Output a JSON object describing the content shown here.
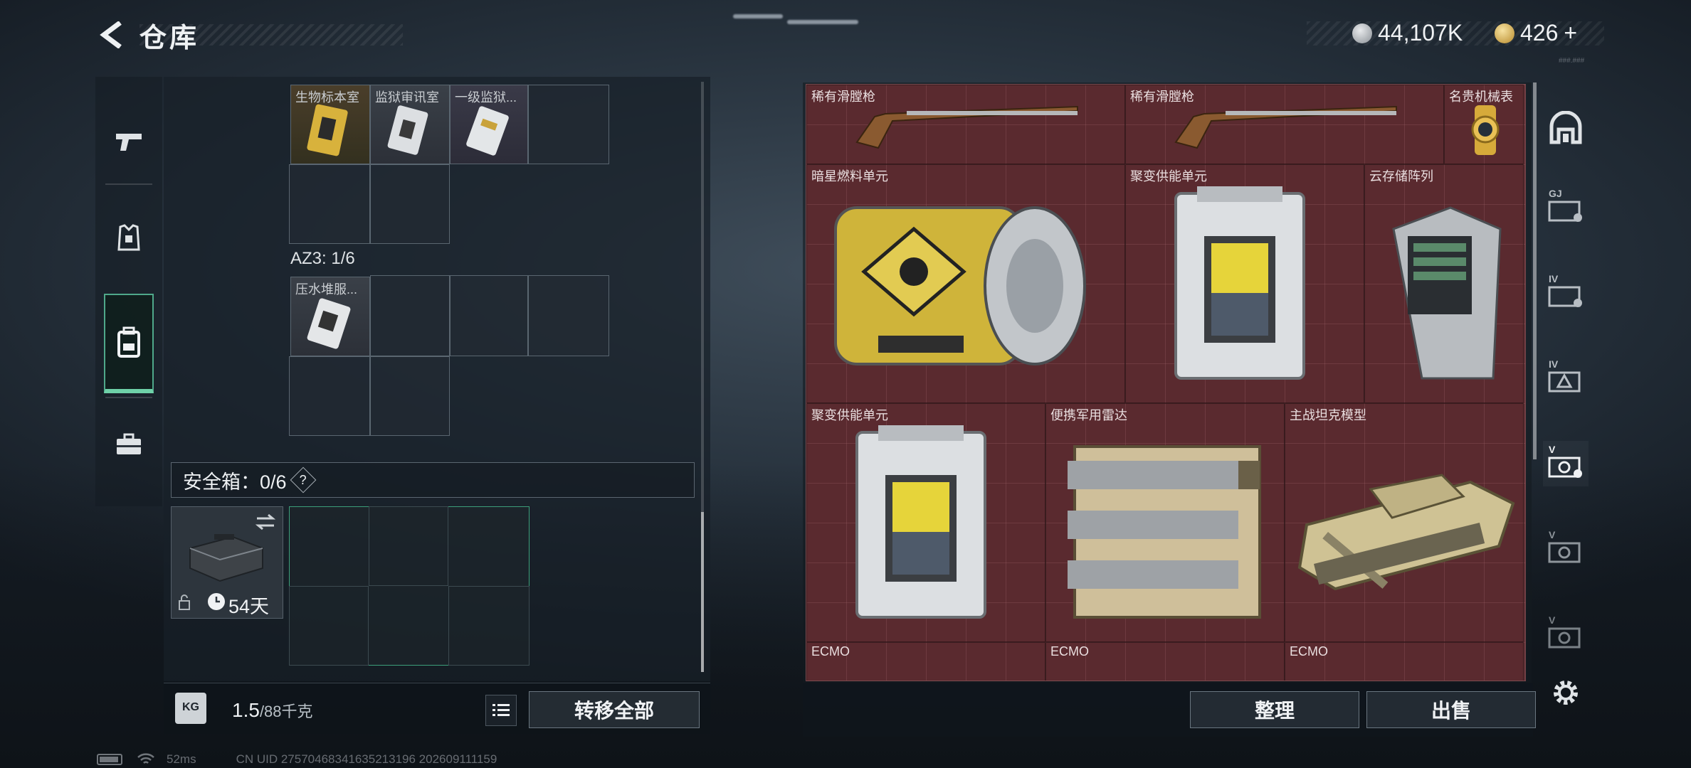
{
  "header": {
    "title": "仓库",
    "currency_silver": "44,107K",
    "currency_gold": "426",
    "gold_add": "+",
    "version": "###.###"
  },
  "left_sidebar": {
    "tabs": [
      "weapon",
      "armor",
      "backpack",
      "case"
    ],
    "active_tab": "backpack"
  },
  "left_panel": {
    "top_items": [
      {
        "label": "生物标本室"
      },
      {
        "label": "监狱审讯室"
      },
      {
        "label": "一级监狱..."
      }
    ],
    "az3_label": "AZ3: 1/6",
    "az3_items": [
      {
        "label": "压水堆服..."
      }
    ],
    "safe_box_label": "安全箱：0/6",
    "help": "?",
    "case_days": "54天",
    "weight_current": "1.5",
    "weight_max": "/88千克",
    "transfer_all": "转移全部"
  },
  "right_panel": {
    "items": [
      {
        "label": "稀有滑膛枪"
      },
      {
        "label": "稀有滑膛枪"
      },
      {
        "label": "名贵机械表"
      },
      {
        "label": "暗星燃料单元"
      },
      {
        "label": "聚变供能单元"
      },
      {
        "label": "云存储阵列"
      },
      {
        "label": "聚变供能单元"
      },
      {
        "label": "便携军用雷达"
      },
      {
        "label": "主战坦克模型"
      },
      {
        "label": "ECMO"
      },
      {
        "label": "ECMO"
      },
      {
        "label": "ECMO"
      }
    ],
    "sort_button": "整理",
    "sell_button": "出售"
  },
  "right_sidebar": {
    "tabs": [
      "base",
      "GJ",
      "IV",
      "IV-alert",
      "V-active",
      "V",
      "V-2"
    ],
    "labels": [
      "",
      "GJ",
      "IV",
      "IV",
      "V",
      "V",
      "V"
    ]
  },
  "status_bar": {
    "ping": "52ms",
    "uid": "CN UID 27570468341635213196 202609111159"
  },
  "colors": {
    "item_bg_red": "#5a2a2f",
    "accent_green": "#4fa88a",
    "panel_dark": "#182028"
  }
}
